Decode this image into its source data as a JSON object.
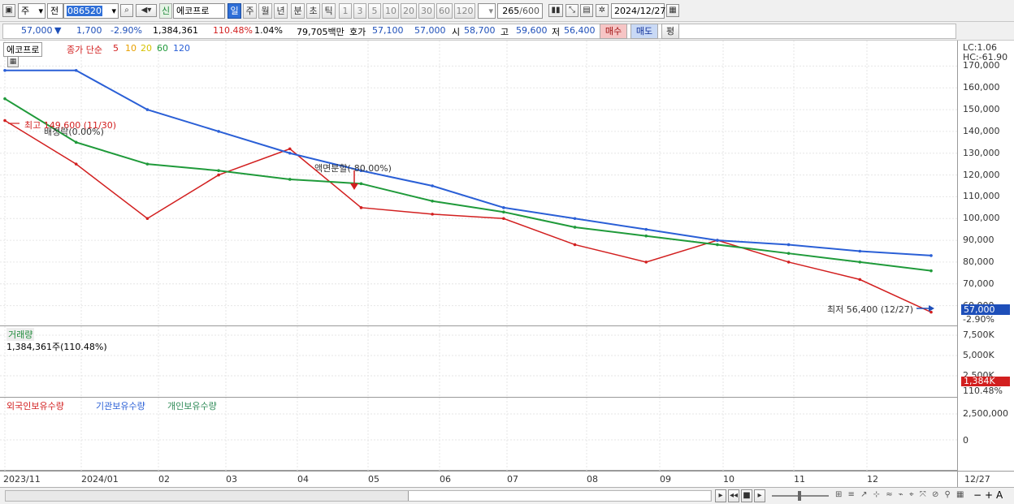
{
  "toolbar": {
    "market_label": "주",
    "type_label": "전",
    "code": "086520",
    "name": "에코프로",
    "name_badge": "신",
    "periods": [
      "일",
      "주",
      "월",
      "년",
      "분",
      "초",
      "틱"
    ],
    "selected_period": "일",
    "intervals": [
      "1",
      "3",
      "5",
      "10",
      "20",
      "30",
      "60",
      "120"
    ],
    "count": "265",
    "count_max": "/600",
    "date": "2024/12/27"
  },
  "quote": {
    "price": "57,000",
    "change_arrow": "▼",
    "change": "1,700",
    "change_pct": "-2.90%",
    "volume": "1,384,361",
    "volume_ratio": "110.48%",
    "turnover": "1.04%",
    "amount": "79,705백만",
    "ask_label": "호가",
    "ask": "57,100",
    "bid": "57,000",
    "open_label": "시",
    "open": "58,700",
    "high_label": "고",
    "high": "59,600",
    "low_label": "저",
    "low": "56,400",
    "buy_label": "매수",
    "sell_label": "매도",
    "eval_label": "평"
  },
  "price_panel": {
    "name": "에코프로",
    "indicator": "종가 단순",
    "ma_periods": [
      "5",
      "10",
      "20",
      "60",
      "120"
    ],
    "ma_colors": [
      "#d21f1f",
      "#e8a000",
      "#f0e000",
      "#1f9a3a",
      "#2a5fd6"
    ],
    "lc": "LC:1.06",
    "hc": "HC:-61.90",
    "high_note": "최고 149,600 (11/30)",
    "split_note1": "배정락(0.00%)",
    "split_note2": "액면분할(-80.00%)",
    "low_note": "최저 56,400 (12/27)",
    "last_price": "57,000",
    "last_change": "-2.90%",
    "y_ticks": [
      "170,000",
      "160,000",
      "150,000",
      "140,000",
      "130,000",
      "120,000",
      "110,000",
      "100,000",
      "90,000",
      "80,000",
      "70,000",
      "60,000"
    ]
  },
  "volume_panel": {
    "title": "거래량",
    "value": "1,384,361주(110.48%)",
    "y_ticks": [
      "7,500K",
      "5,000K",
      "2,500K"
    ],
    "last": "1,384K",
    "last_pct": "110.48%"
  },
  "holding_panel": {
    "series": [
      "외국인보유수량",
      "기관보유수량",
      "개인보유수량"
    ],
    "colors": [
      "#d21f1f",
      "#2a5fd6",
      "#2e8b57"
    ],
    "y_ticks": [
      "2,500,000",
      "0"
    ]
  },
  "x_axis": [
    "2023/11",
    "2024/01",
    "02",
    "03",
    "04",
    "05",
    "06",
    "07",
    "08",
    "09",
    "10",
    "11",
    "12",
    "12/27"
  ],
  "chart_data": {
    "type": "line",
    "title": "에코프로",
    "x": [
      "2023/11",
      "2024/01",
      "02",
      "03",
      "04",
      "05",
      "06",
      "07",
      "08",
      "09",
      "10",
      "11",
      "12",
      "12/27"
    ],
    "series": [
      {
        "name": "종가",
        "values": [
          145000,
          125000,
          100000,
          120000,
          132000,
          105000,
          102000,
          100000,
          88000,
          80000,
          90000,
          80000,
          72000,
          57000
        ]
      },
      {
        "name": "120",
        "values": [
          168000,
          168000,
          150000,
          140000,
          130000,
          122000,
          115000,
          105000,
          100000,
          95000,
          90000,
          88000,
          85000,
          83000
        ]
      },
      {
        "name": "60",
        "values": [
          155000,
          135000,
          125000,
          122000,
          118000,
          116000,
          108000,
          103000,
          96000,
          92000,
          88000,
          84000,
          80000,
          76000
        ]
      }
    ],
    "ylim": [
      55000,
      175000
    ],
    "volume_ylim": [
      0,
      8000000
    ],
    "grid": true
  }
}
